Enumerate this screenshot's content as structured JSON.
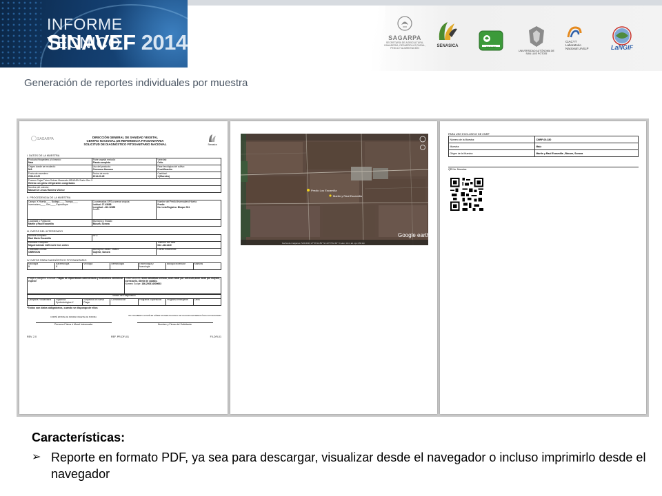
{
  "header": {
    "banner_line1": "INFORME TÉCNICO",
    "banner_line2a": "SINAVEF",
    "banner_line2b": "2014",
    "logos": [
      {
        "name": "SAGARPA",
        "caption": "SECRETARÍA DE AGRICULTURA, GANADERÍA, DESARROLLO RURAL, PESCA Y ALIMENTACIÓN"
      },
      {
        "name": "SENASICA",
        "caption": "SENASICA"
      },
      {
        "name": "SINAVEF",
        "caption": "SINAVEF"
      },
      {
        "name": "UASLP",
        "caption": "UNIVERSIDAD AUTÓNOMA DE SAN LUIS POTOSÍ"
      },
      {
        "name": "CIACYT",
        "caption": "CIACYT Laboratorio Nacional UASLP"
      },
      {
        "name": "LaNGIF",
        "caption": "LaNGIF"
      }
    ]
  },
  "subtitle": "Generación de reportes individuales por muestra",
  "form": {
    "title1": "DIRECCIÓN GENERAL DE SANIDAD VEGETAL",
    "title2": "CENTRO NACIONAL DE REFERENCIA FITOSANITARIA",
    "title3": "SOLICITUD DE DIAGNÓSTICO FITOSANITARIO NACIONAL",
    "sagarpa": "SAGARPA",
    "senasica": "Senasica",
    "sec1": "I. DATOS DE LA MUESTRA",
    "producto_label": "Producto/Hospedero y/o insecto:",
    "producto": "Maíz",
    "parte_label": "Parte vegetal enviada:",
    "parte": "Planta completa",
    "variedad_label": "Variedad:",
    "variedad": "Celio",
    "origen_label": "Origen donde se recolectó:",
    "origen": "N/A",
    "uso_label": "Uso del producto:",
    "uso": "Consumo Humano",
    "fase_label": "Fase fenológica del cultivo:",
    "fase": "Fructificación",
    "fecha_muestreo_label": "Fecha de muestreo:",
    "fecha_muestreo": "2014-03-25",
    "fecha_envio_label": "Fecha de envío:",
    "fecha_envio": "2014-03-26",
    "cantidad_label": "Cantidad:",
    "cantidad": "1 (Muestra)",
    "envases": "Frascos    Cajas    Tubos    Sobres    Macerado    ARN/ADN    Suelo    Otro X",
    "envase_nota": "Hielera con geles refrigerantes congelados",
    "colector_label": "Nombre del colector:",
    "colector": "Manuel De Jesus Ramírez Vilchez",
    "sec2": "II. PROCEDENCIA DE LA MUESTRA",
    "campo": "Campo: X  Huerta____ Bodega____ Trampa____ Invernadero____ Otro____ Especifique",
    "coords_label": "Coordenadas GPS y anexar croquis:",
    "latitud": "Latitud: 27.43688",
    "longitud": "Longitud: -110.12855",
    "anexo": "Anexo.",
    "predio_label": "Nombre del Predio/Invernadero/Huerto:",
    "predio": "Predio",
    "lote": "No. Lote/Registro: Bloque 511",
    "localidad_label": "Localidad o Población:",
    "localidad": "Martin y Raul Escamilla",
    "municipio_label": "Municipio y Estado:",
    "municipio": "Bácum, Sonora",
    "sec3": "III. DATOS DEL INTERESADO",
    "nombre_label": "Nombre completo:",
    "nombre": "Raul Mario Escamilla",
    "rfc_label": "RFC:",
    "domicilio_label": "Domicilio Completo:",
    "domicilio": "Miguel Alemán #420 norte Col. centro",
    "tel_label": "Teléfono con lada",
    "tel": "644 -4141440",
    "localidad2_label": "Localidad/Colonia:",
    "localidad2": "OBREGON",
    "municipio2_label": "Municipio/Ciudad: Estado:",
    "municipio2": "Cajeme, Sonora",
    "correo_label": "Correo electrónico:",
    "sec4": "IV. DATOS PARA DIAGNÓSTICO FITOSANITARIO",
    "diag_cols": [
      "Micología",
      "Bacteriología",
      "Virología",
      "Nematología",
      "Entomología y Acarología",
      "Biología Molecular",
      "Malezas"
    ],
    "diag_marks": [
      "X",
      "X",
      "",
      "",
      "",
      "",
      ""
    ],
    "plaga_label": "Plaga ó patógeno a buscar:",
    "plaga": "Plagas de importancia cuarentenaria y económica. Identificar especie",
    "obs_label": "Observaciones:",
    "obs": "tizón bandeado vertical, tizón foliar por turcicum,tizón foliar por maydis, cornezuelo, diente de caballo.",
    "scope_label": "Número Scope:",
    "scope": "186-250314000663",
    "motivo": "Motivo del Diagnóstico",
    "motivo_cols": [
      "Campaña Fitosanitaria",
      "Vigilancia Epidemiológica X",
      "Sospecha de Nueva Plaga",
      "Corroboración",
      "Programa Exportación",
      "Programa emergente",
      "Otros"
    ],
    "obligatorios": "*Todos son datos obligatorios, cuando se disponga de ellos",
    "firma1_org": "COMITÉ ESTATAL DE SANIDAD VEGETAL DE SONORA",
    "firma1": "Persona Física ó Moral Interesada",
    "firma2_org": "ING. RIGOBERTO GONZÁLEZ GÓMEZ SISTEMA NACIONAL DE VIGILANCIA EPIDEMIOLÓGICA FITOSANITARIA",
    "firma2": "Nombre y Firma del Solicitante",
    "rev": "REV. 2.0",
    "ref": "REF. PR-DFI-01",
    "fo": "F0-DFI-01"
  },
  "map": {
    "label1": "Predio Los Escamilla",
    "label2": "Martin y Raul Escamilla",
    "brand": "Google earth",
    "footer": "Fecha de imágenes: 5/11/2013   27°26'12.89\" N 110°07'42.91\" O   elev. 12 m   alt. ojo 4.66 km"
  },
  "cnrf": {
    "header": "PARA USO EXCLUSIVO DE CNRF",
    "rows": [
      {
        "label": "Número de la Muestra:",
        "value": "CNRF-00-330"
      },
      {
        "label": "Muestra:",
        "value": "Maíz"
      },
      {
        "label": "Origen de la Muestra:",
        "value": "Martin y Raul Escamilla , Bácum, Sonora"
      }
    ],
    "qr_label": "QR No. Muestra:"
  },
  "characteristics": {
    "title": "Características:",
    "arrow": "➢",
    "bullet": "Reporte en formato PDF, ya sea para descargar, visualizar desde el navegador o incluso imprimirlo desde el navegador"
  }
}
